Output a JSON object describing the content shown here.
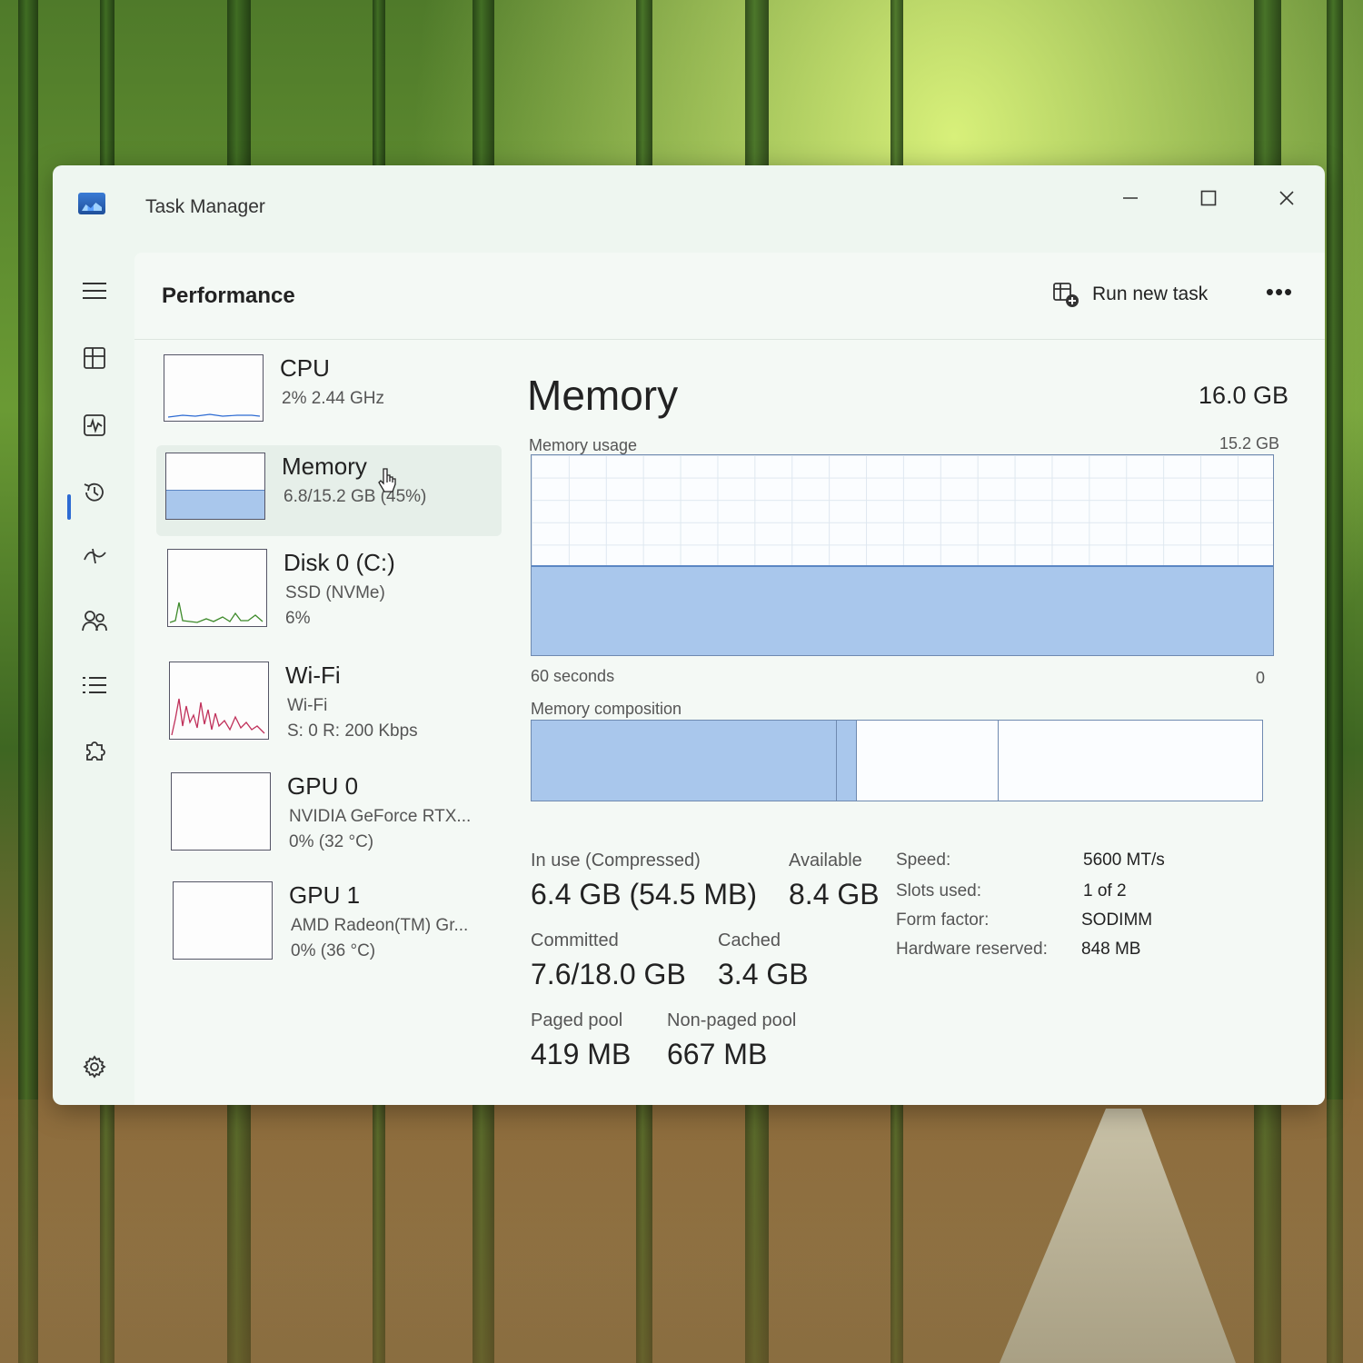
{
  "window": {
    "title": "Task Manager"
  },
  "header": {
    "page_title": "Performance",
    "run_task_label": "Run new task",
    "more_label": "•••"
  },
  "resources": [
    {
      "name": "CPU",
      "sub1": "2%  2.44 GHz",
      "sub2": "",
      "sub3": ""
    },
    {
      "name": "Memory",
      "sub1": "6.8/15.2 GB (45%)",
      "sub2": "",
      "sub3": ""
    },
    {
      "name": "Disk 0 (C:)",
      "sub1": "SSD (NVMe)",
      "sub2": "6%",
      "sub3": ""
    },
    {
      "name": "Wi-Fi",
      "sub1": "Wi-Fi",
      "sub2": "S: 0  R: 200 Kbps",
      "sub3": ""
    },
    {
      "name": "GPU 0",
      "sub1": "NVIDIA GeForce RTX...",
      "sub2": "0%  (32 °C)",
      "sub3": ""
    },
    {
      "name": "GPU 1",
      "sub1": "AMD Radeon(TM) Gr...",
      "sub2": "0%  (36 °C)",
      "sub3": ""
    }
  ],
  "memory": {
    "title": "Memory",
    "total": "16.0 GB",
    "usage_label": "Memory usage",
    "usage_max": "15.2 GB",
    "usage_fraction": 0.45,
    "time_left": "60 seconds",
    "time_right": "0",
    "composition_label": "Memory composition",
    "stats": {
      "in_use_label": "In use (Compressed)",
      "in_use_value": "6.4 GB (54.5 MB)",
      "available_label": "Available",
      "available_value": "8.4 GB",
      "committed_label": "Committed",
      "committed_value": "7.6/18.0 GB",
      "cached_label": "Cached",
      "cached_value": "3.4 GB",
      "paged_label": "Paged pool",
      "paged_value": "419 MB",
      "nonpaged_label": "Non-paged pool",
      "nonpaged_value": "667 MB"
    },
    "details": [
      {
        "key": "Speed:",
        "value": "5600 MT/s"
      },
      {
        "key": "Slots used:",
        "value": "1 of 2"
      },
      {
        "key": "Form factor:",
        "value": "SODIMM"
      },
      {
        "key": "Hardware reserved:",
        "value": "848 MB"
      }
    ]
  },
  "colors": {
    "accent": "#2d6bd3",
    "memory_fill": "#a9c7ec",
    "memory_line": "#5b86c4",
    "wifi_line": "#c0305a",
    "disk_line": "#3d8a2a"
  }
}
